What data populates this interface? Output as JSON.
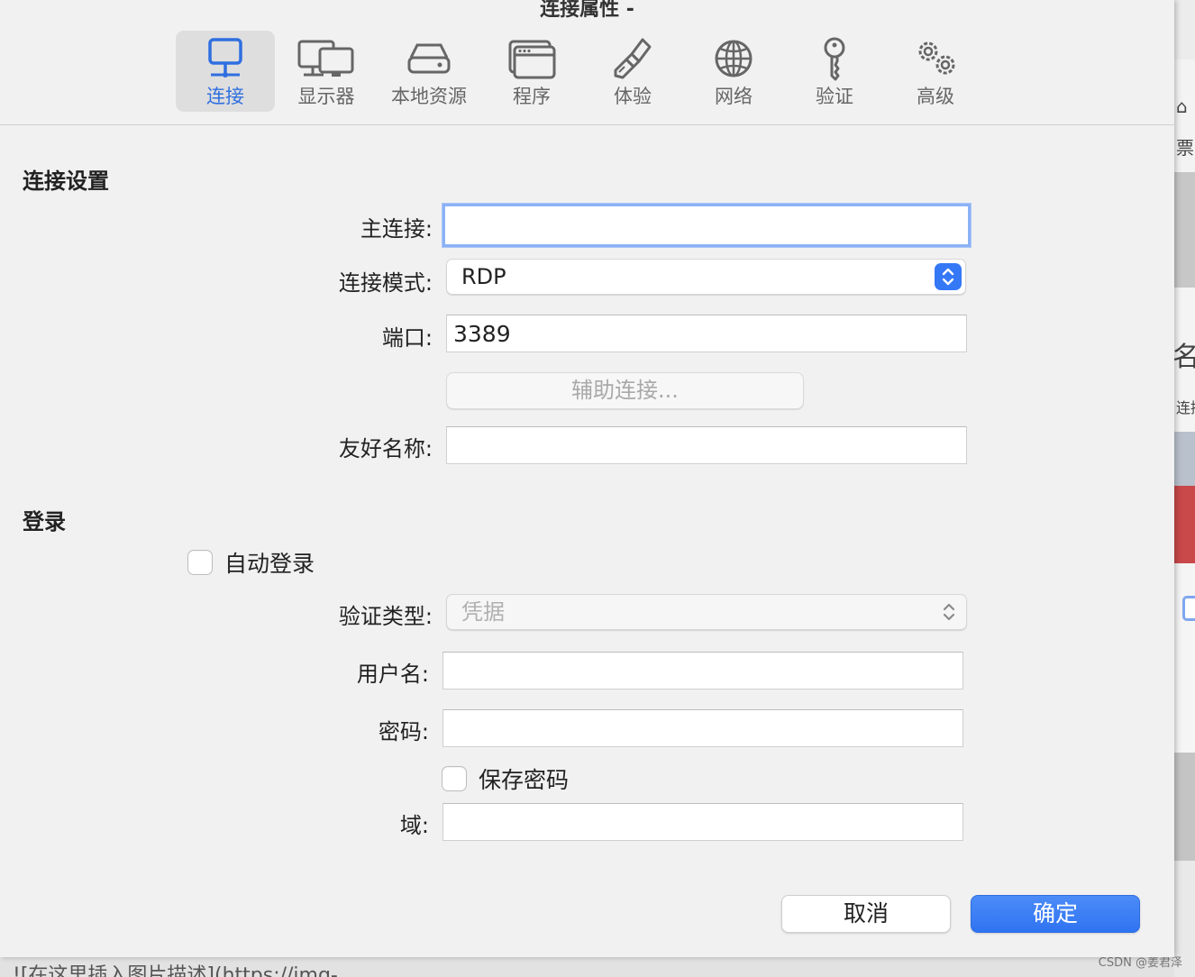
{
  "window": {
    "title": "连接属性 -"
  },
  "toolbar": {
    "items": [
      {
        "label": "连接",
        "icon": "monitor-icon",
        "active": true
      },
      {
        "label": "显示器",
        "icon": "displays-icon",
        "active": false
      },
      {
        "label": "本地资源",
        "icon": "drive-icon",
        "active": false
      },
      {
        "label": "程序",
        "icon": "program-window-icon",
        "active": false
      },
      {
        "label": "体验",
        "icon": "brush-icon",
        "active": false
      },
      {
        "label": "网络",
        "icon": "globe-icon",
        "active": false
      },
      {
        "label": "验证",
        "icon": "key-icon",
        "active": false
      },
      {
        "label": "高级",
        "icon": "gears-icon",
        "active": false
      }
    ]
  },
  "connection": {
    "section_title": "连接设置",
    "host_label": "主连接:",
    "host_value": "",
    "mode_label": "连接模式:",
    "mode_value": "RDP",
    "port_label": "端口:",
    "port_value": "3389",
    "assist_label": "辅助连接...",
    "friendly_label": "友好名称:",
    "friendly_value": ""
  },
  "login": {
    "section_title": "登录",
    "auto_login_label": "自动登录",
    "auto_login_checked": false,
    "auth_type_label": "验证类型:",
    "auth_type_value": "凭据",
    "username_label": "用户名:",
    "username_value": "",
    "password_label": "密码:",
    "password_value": "",
    "save_password_label": "保存密码",
    "save_password_checked": false,
    "domain_label": "域:",
    "domain_value": ""
  },
  "buttons": {
    "cancel": "取消",
    "ok": "确定"
  },
  "background": {
    "side_text_1": "票",
    "side_text_2": "名",
    "side_text_3": "连接",
    "bottom_text": "![在这里插入图片描述](https://img-",
    "watermark": "CSDN @姜君泽"
  },
  "colors": {
    "accent": "#3478f6",
    "focus_ring": "#8cb2f5",
    "danger_band": "#c9484a"
  }
}
